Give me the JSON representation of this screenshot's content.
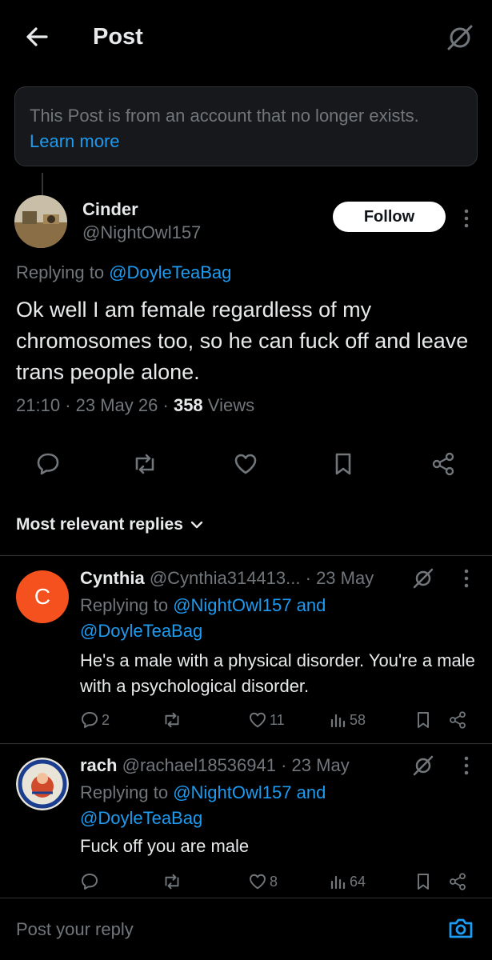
{
  "header": {
    "title": "Post"
  },
  "notice": {
    "text": "This Post is from an account that no longer exists.",
    "link": "Learn more"
  },
  "post": {
    "name": "Cinder",
    "handle": "@NightOwl157",
    "follow_label": "Follow",
    "replying_prefix": "Replying to",
    "replying_to": "@DoyleTeaBag",
    "text": "Ok well I am female regardless of my chromosomes too, so he can fuck off and leave trans people alone.",
    "time": "21:10",
    "date": "23 May 26",
    "views_count": "358",
    "views_label": "Views"
  },
  "replies_section": {
    "label": "Most relevant replies"
  },
  "replies": [
    {
      "avatar_letter": "C",
      "name": "Cynthia",
      "handle": "@Cynthia314413...",
      "date": "· 23 May",
      "replying_prefix": "Replying to",
      "replying_to": "@NightOwl157 and @DoyleTeaBag",
      "text": "He's a male with a physical disorder. You're a male with a psychological disorder.",
      "reply_count": "2",
      "like_count": "11",
      "view_count": "58"
    },
    {
      "avatar_text": "AUSTRALIA FIRST",
      "name": "rach",
      "handle": "@rachael18536941",
      "date": "· 23 May",
      "replying_prefix": "Replying to",
      "replying_to": "@NightOwl157 and @DoyleTeaBag",
      "text": "Fuck off you are male",
      "like_count": "8",
      "view_count": "64"
    }
  ],
  "compose": {
    "placeholder": "Post your reply"
  },
  "colors": {
    "accent": "#1d9bf0",
    "muted": "#71767b",
    "background": "#000000",
    "avatar_c": "#f4511e"
  }
}
